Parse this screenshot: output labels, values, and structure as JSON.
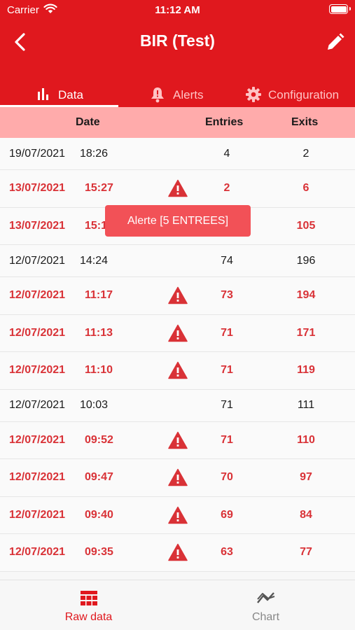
{
  "status_bar": {
    "carrier": "Carrier",
    "time": "11:12 AM"
  },
  "header": {
    "title": "BIR (Test)",
    "back_icon": "chevron-left-icon",
    "edit_icon": "pencil-icon"
  },
  "tabs": [
    {
      "label": "Data",
      "icon": "bar-chart-icon",
      "selected": true
    },
    {
      "label": "Alerts",
      "icon": "bell-icon",
      "selected": false
    },
    {
      "label": "Configuration",
      "icon": "gear-icon",
      "selected": false
    }
  ],
  "table": {
    "columns": [
      "Date",
      "Entries",
      "Exits"
    ],
    "rows": [
      {
        "date": "19/07/2021",
        "time": "18:26",
        "entries": "4",
        "exits": "2",
        "alert": false
      },
      {
        "date": "13/07/2021",
        "time": "15:27",
        "entries": "2",
        "exits": "6",
        "alert": true
      },
      {
        "date": "13/07/2021",
        "time": "15:1",
        "entries": "",
        "exits": "105",
        "alert": true
      },
      {
        "date": "12/07/2021",
        "time": "14:24",
        "entries": "74",
        "exits": "196",
        "alert": false
      },
      {
        "date": "12/07/2021",
        "time": "11:17",
        "entries": "73",
        "exits": "194",
        "alert": true
      },
      {
        "date": "12/07/2021",
        "time": "11:13",
        "entries": "71",
        "exits": "171",
        "alert": true
      },
      {
        "date": "12/07/2021",
        "time": "11:10",
        "entries": "71",
        "exits": "119",
        "alert": true
      },
      {
        "date": "12/07/2021",
        "time": "10:03",
        "entries": "71",
        "exits": "111",
        "alert": false
      },
      {
        "date": "12/07/2021",
        "time": "09:52",
        "entries": "71",
        "exits": "110",
        "alert": true
      },
      {
        "date": "12/07/2021",
        "time": "09:47",
        "entries": "70",
        "exits": "97",
        "alert": true
      },
      {
        "date": "12/07/2021",
        "time": "09:40",
        "entries": "69",
        "exits": "84",
        "alert": true
      },
      {
        "date": "12/07/2021",
        "time": "09:35",
        "entries": "63",
        "exits": "77",
        "alert": true
      }
    ]
  },
  "tooltip": {
    "text": "Alerte [5 ENTREES]"
  },
  "bottom_nav": [
    {
      "label": "Raw data",
      "icon": "table-icon",
      "selected": true
    },
    {
      "label": "Chart",
      "icon": "line-chart-icon",
      "selected": false
    }
  ],
  "colors": {
    "primary": "#e0181e",
    "alert_text": "#d93237",
    "table_header_bg": "#ffabab",
    "tooltip_bg": "#f25157"
  }
}
